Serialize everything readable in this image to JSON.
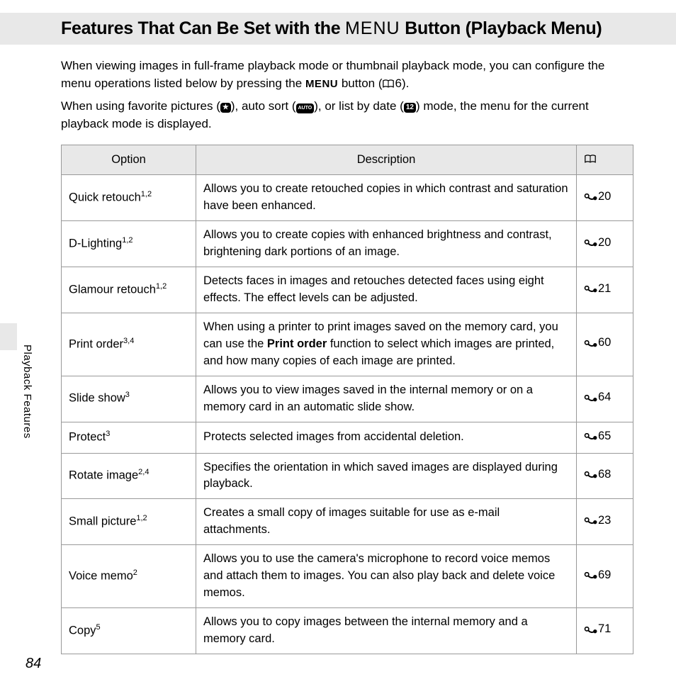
{
  "title": {
    "pre": "Features That Can Be Set with the ",
    "menu": "MENU",
    "post": " Button (Playback Menu)"
  },
  "intro": {
    "p1a": "When viewing images in full-frame playback mode or thumbnail playback mode, you can configure the menu operations listed below by pressing the ",
    "p1_menu": "MENU",
    "p1b": " button (",
    "p1_ref": "6",
    "p1c": ").",
    "p2a": "When using favorite pictures (",
    "p2b": "), auto sort (",
    "p2c": "), or list by date (",
    "p2d": ") mode, the menu for the current playback mode is displayed."
  },
  "icons": {
    "fav": "★",
    "auto": "AUTO",
    "date": "12"
  },
  "table": {
    "headers": {
      "option": "Option",
      "description": "Description"
    },
    "rows": [
      {
        "opt": "Quick retouch",
        "sup": "1,2",
        "desc": "Allows you to create retouched copies in which contrast and saturation have been enhanced.",
        "ref": "20"
      },
      {
        "opt": "D-Lighting",
        "sup": "1,2",
        "desc": "Allows you to create copies with enhanced brightness and contrast, brightening dark portions of an image.",
        "ref": "20"
      },
      {
        "opt": "Glamour retouch",
        "sup": "1,2",
        "desc": "Detects faces in images and retouches detected faces using eight effects. The effect levels can be adjusted.",
        "ref": "21"
      },
      {
        "opt": "Print order",
        "sup": "3,4",
        "desc_pre": "When using a printer to print images saved on the memory card, you can use the ",
        "desc_bold": "Print order",
        "desc_post": " function to select which images are printed, and how many copies of each image are printed.",
        "ref": "60"
      },
      {
        "opt": "Slide show",
        "sup": "3",
        "desc": "Allows you to view images saved in the internal memory or on a memory card in an automatic slide show.",
        "ref": "64"
      },
      {
        "opt": "Protect",
        "sup": "3",
        "desc": "Protects selected images from accidental deletion.",
        "ref": "65"
      },
      {
        "opt": "Rotate image",
        "sup": "2,4",
        "desc": "Specifies the orientation in which saved images are displayed during playback.",
        "ref": "68"
      },
      {
        "opt": "Small picture",
        "sup": "1,2",
        "desc": "Creates a small copy of images suitable for use as e-mail attachments.",
        "ref": "23"
      },
      {
        "opt": "Voice memo",
        "sup": "2",
        "desc": "Allows you to use the camera's microphone to record voice memos and attach them to images. You can also play back and delete voice memos.",
        "ref": "69"
      },
      {
        "opt": "Copy",
        "sup": "5",
        "desc": "Allows you to copy images between the internal memory and a memory card.",
        "ref": "71"
      }
    ]
  },
  "side_label": "Playback Features",
  "page_number": "84"
}
